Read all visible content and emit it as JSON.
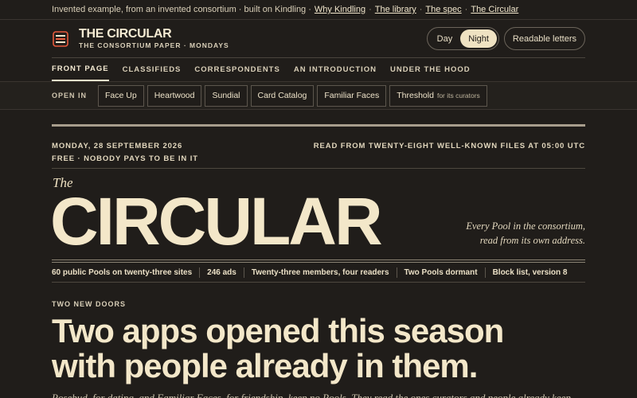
{
  "topstrip": {
    "intro": "Invented example, from an invented consortium · built on Kindling ·",
    "links": [
      "Why Kindling",
      "The library",
      "The spec",
      "The Circular"
    ]
  },
  "masthead": {
    "logo_icon": "stacked-pages-logo",
    "title": "THE CIRCULAR",
    "subtitle": "THE CONSORTIUM PAPER · MONDAYS",
    "theme_toggle": {
      "options": [
        "Day",
        "Night"
      ],
      "selected": "Night"
    },
    "readable_label": "Readable letters"
  },
  "nav": {
    "items": [
      "FRONT PAGE",
      "CLASSIFIEDS",
      "CORRESPONDENTS",
      "AN INTRODUCTION",
      "UNDER THE HOOD"
    ],
    "active": "FRONT PAGE"
  },
  "open_in": {
    "label": "OPEN IN",
    "apps": [
      {
        "name": "Face Up",
        "note": ""
      },
      {
        "name": "Heartwood",
        "note": ""
      },
      {
        "name": "Sundial",
        "note": ""
      },
      {
        "name": "Card Catalog",
        "note": ""
      },
      {
        "name": "Familiar Faces",
        "note": ""
      },
      {
        "name": "Threshold",
        "note": "for its curators"
      }
    ]
  },
  "paper": {
    "date": "MONDAY, 28 SEPTEMBER 2026",
    "read_from": "READ FROM TWENTY-EIGHT WELL-KNOWN FILES AT 05:00 UTC",
    "price": "FREE · NOBODY PAYS TO BE IN IT",
    "the": "The",
    "title": "CIRCULAR",
    "tagline_1": "Every Pool in the consortium,",
    "tagline_2": "read from its own address.",
    "stats": [
      "60 public Pools on twenty-three sites",
      "246 ads",
      "Twenty-three members, four readers",
      "Two Pools dormant",
      "Block list, version 8"
    ],
    "kicker": "TWO NEW DOORS",
    "headline_1": "Two apps opened this season",
    "headline_2": "with people already in them.",
    "deck": "Rosebud, for dating, and Familiar Faces, for friendship, keep no Pools. They read the ones curators and people already keep."
  }
}
